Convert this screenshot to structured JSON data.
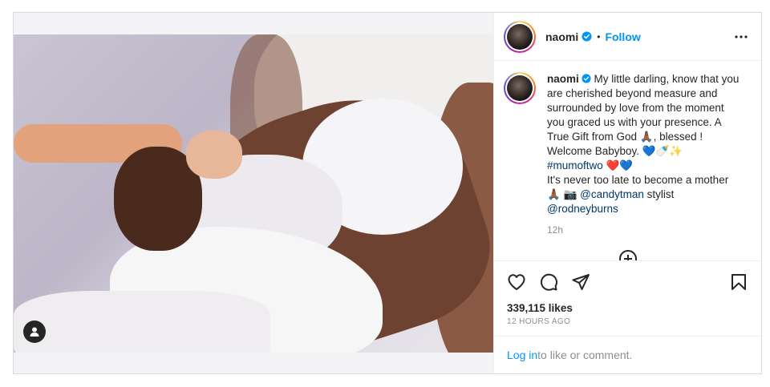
{
  "post": {
    "user": {
      "username": "naomi",
      "follow_label": "Follow",
      "separator": "•"
    },
    "caption": {
      "username": "naomi",
      "text_part1": " My little darling, know that you are cherished beyond measure and surrounded by love from the moment you graced us with your presence. A True Gift from God 🙏🏾, blessed ! Welcome Babyboy. 💙🍼✨",
      "hashtag": "#mumoftwo",
      "hashtag_emoji": " ❤️💙",
      "line2": "It's never too late to become a mother",
      "line3_prefix": "🙏🏾 📷 ",
      "mention1": "@candytman",
      "mention1_suffix": " stylist",
      "mention2": "@rodneyburns",
      "time": "12h"
    },
    "likes": "339,115 likes",
    "posted_ago": "12 HOURS AGO",
    "login_link": "Log in",
    "login_text": " to like or comment."
  },
  "icons": {
    "verified": "verified-badge-icon",
    "more": "more-options-icon",
    "like": "heart-icon",
    "comment": "comment-icon",
    "share": "paper-plane-icon",
    "save": "bookmark-icon",
    "tag": "user-tag-icon",
    "load_more": "plus-circle-icon"
  },
  "colors": {
    "accent": "#0095f6",
    "verified": "#0095f6",
    "text": "#262626",
    "muted": "#8e8e8e",
    "border": "#dbdbdb"
  }
}
